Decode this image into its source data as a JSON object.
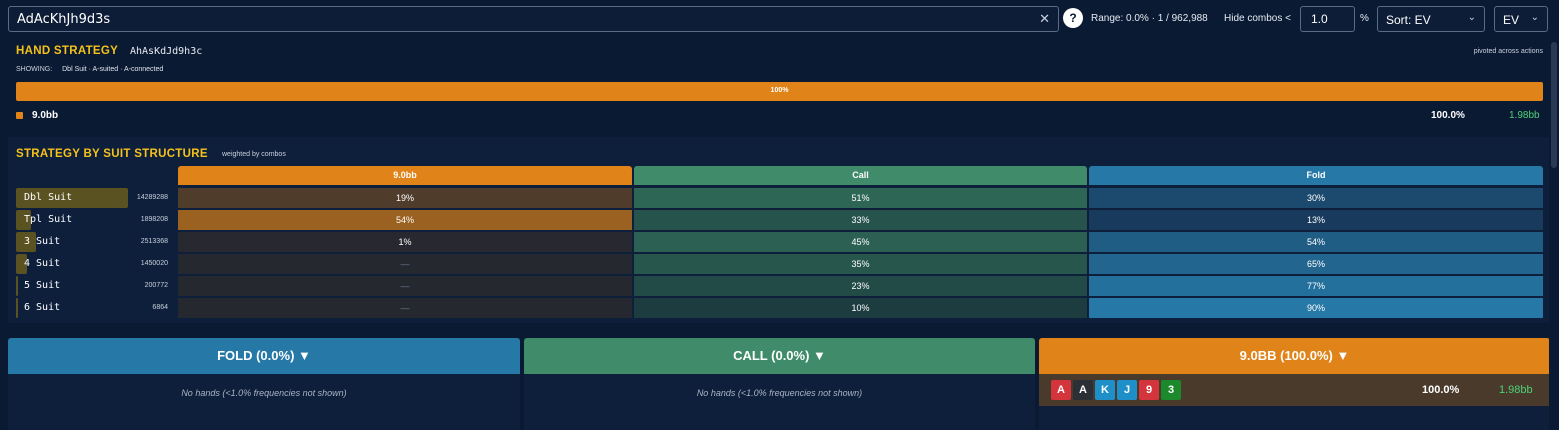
{
  "search": {
    "value": "AdAcKhJh9d3s"
  },
  "help_label": "?",
  "range_text": "Range: 0.0% · 1 / 962,988",
  "hide_combos": {
    "label": "Hide combos <",
    "value": "1.0",
    "unit": "%"
  },
  "sort": {
    "value": "Sort: EV"
  },
  "metric": {
    "value": "EV"
  },
  "hand_strategy": {
    "title": "HAND STRATEGY",
    "hand": "AhAsKdJd9h3c",
    "pivot_note": "pivoted across actions",
    "showing_label": "SHOWING:",
    "showing_value": "Dbl Suit · A-suited · A-connected",
    "bar_label": "100%",
    "bar_fraction": 1.0,
    "legend": {
      "action": "9.0bb",
      "pct": "100.0%",
      "ev": "1.98bb"
    }
  },
  "suit_structure": {
    "title": "STRATEGY BY SUIT STRUCTURE",
    "subtitle": "weighted by combos",
    "columns": [
      "9.0bb",
      "Call",
      "Fold"
    ],
    "rows": [
      {
        "name": "Dbl Suit",
        "count": "14289288",
        "weight": 1.0,
        "values": [
          "19%",
          "51%",
          "30%"
        ]
      },
      {
        "name": "Tpl Suit",
        "count": "1898208",
        "weight": 0.133,
        "values": [
          "54%",
          "33%",
          "13%"
        ]
      },
      {
        "name": "3 Suit",
        "count": "2513368",
        "weight": 0.176,
        "values": [
          "1%",
          "45%",
          "54%"
        ]
      },
      {
        "name": "4 Suit",
        "count": "1450020",
        "weight": 0.101,
        "values": [
          "—",
          "35%",
          "65%"
        ]
      },
      {
        "name": "5 Suit",
        "count": "200772",
        "weight": 0.014,
        "values": [
          "—",
          "23%",
          "77%"
        ]
      },
      {
        "name": "6 Suit",
        "count": "6864",
        "weight": 0.0005,
        "values": [
          "—",
          "10%",
          "90%"
        ]
      }
    ]
  },
  "panels": [
    {
      "title": "FOLD (0.0%) ▼",
      "empty_text": "No hands (<1.0% frequencies not shown)"
    },
    {
      "title": "CALL (0.0%) ▼",
      "empty_text": "No hands (<1.0% frequencies not shown)"
    },
    {
      "title": "9.0BB (100.0%) ▼"
    }
  ],
  "hand_row": {
    "cards": [
      {
        "rank": "A",
        "suit_color": "#d4343c"
      },
      {
        "rank": "A",
        "suit_color": "#2b2f36"
      },
      {
        "rank": "K",
        "suit_color": "#1f8fc9"
      },
      {
        "rank": "J",
        "suit_color": "#1f8fc9"
      },
      {
        "rank": "9",
        "suit_color": "#d4343c"
      },
      {
        "rank": "3",
        "suit_color": "#1c8a2c"
      }
    ],
    "pct": "100.0%",
    "ev": "1.98bb"
  },
  "colors": {
    "raise": "#e08318",
    "call": "#3f8b6a",
    "fold": "#2678a6",
    "ev_positive": "#4dd277",
    "heading": "#f5c21b"
  }
}
